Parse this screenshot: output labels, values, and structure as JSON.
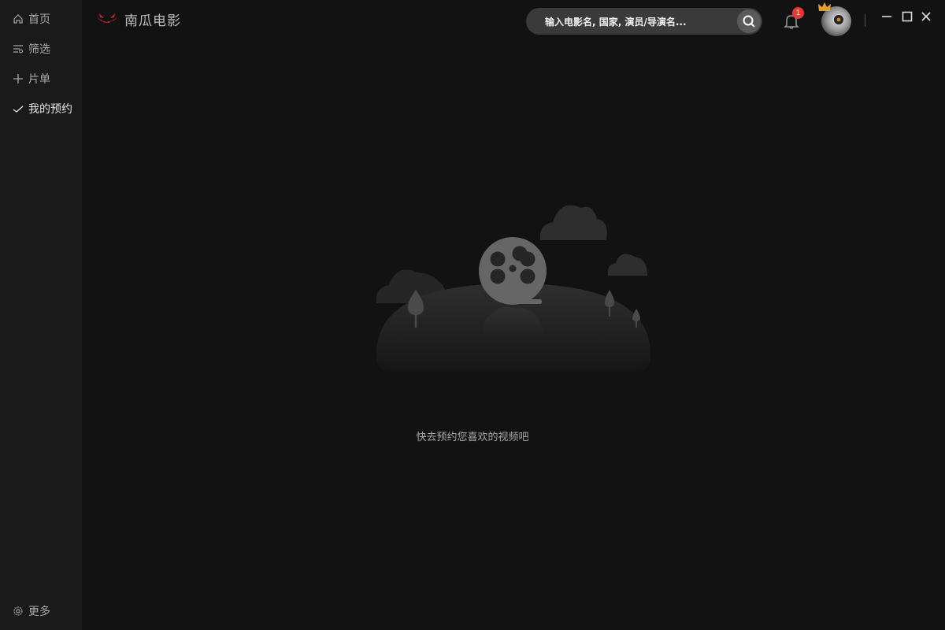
{
  "app": {
    "logo_text": "南瓜电影"
  },
  "sidebar": {
    "items": [
      {
        "label": "首页",
        "icon": "home-icon"
      },
      {
        "label": "筛选",
        "icon": "filter-icon"
      },
      {
        "label": "片单",
        "icon": "plus-icon"
      },
      {
        "label": "我的预约",
        "icon": "check-icon",
        "active": true
      }
    ],
    "more": {
      "label": "更多",
      "icon": "gear-icon"
    }
  },
  "header": {
    "search": {
      "placeholder": "输入电影名, 国家, 演员/导演名..."
    },
    "notifications": {
      "count": "1"
    }
  },
  "main": {
    "empty_message": "快去预约您喜欢的视频吧"
  },
  "colors": {
    "sidebar_bg": "#1a1a1a",
    "main_bg": "#121212",
    "badge": "#e53935",
    "search_bg": "#3a3a3a"
  }
}
